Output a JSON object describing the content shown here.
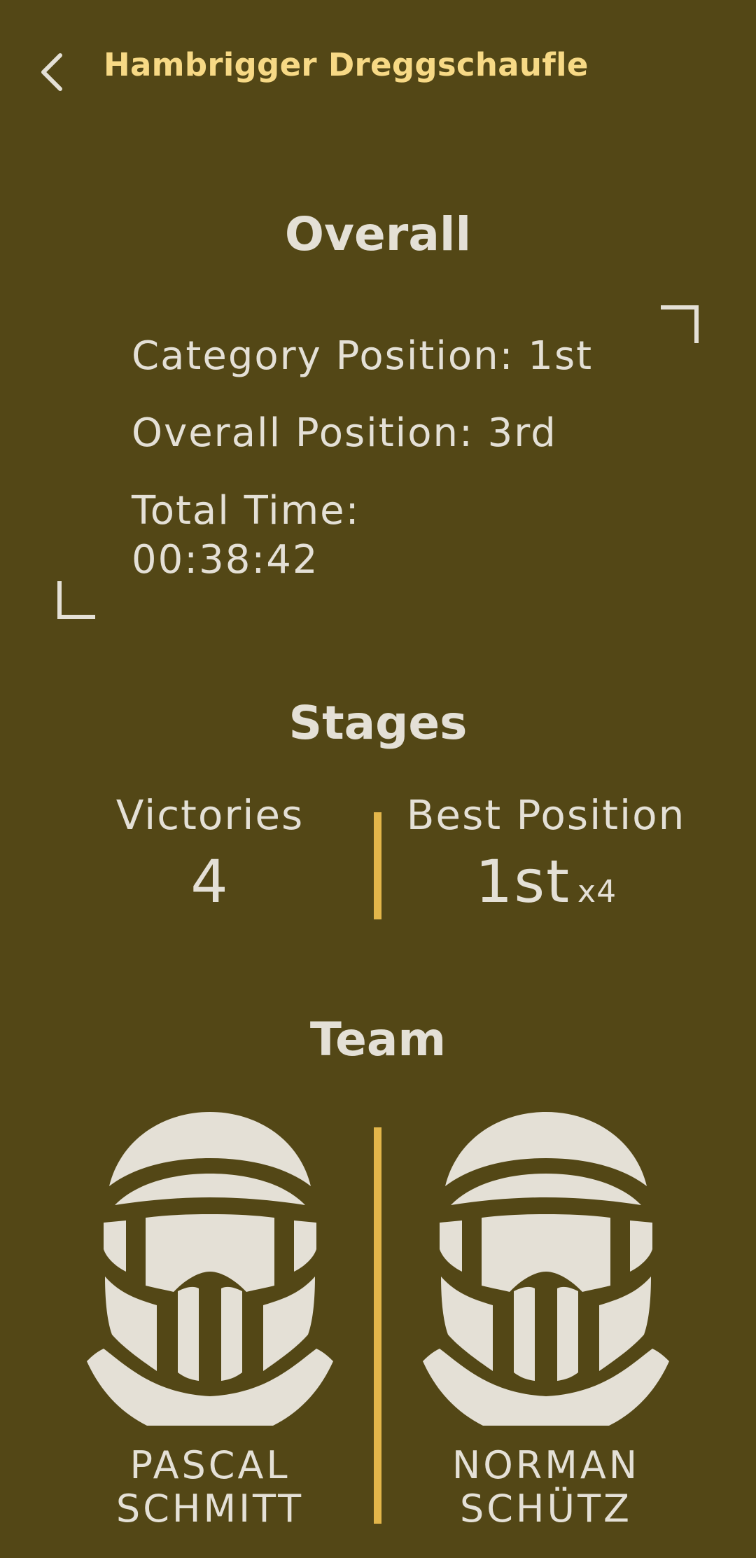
{
  "header": {
    "back_icon": "chevron-left-icon",
    "title": "Hambrigger Dreggschaufle"
  },
  "overall": {
    "title": "Overall",
    "category_position": "Category Position: 1st",
    "overall_position": "Overall Position: 3rd",
    "total_time_label": "Total Time:",
    "total_time_value": "00:38:42"
  },
  "stages": {
    "title": "Stages",
    "victories_label": "Victories",
    "victories_value": "4",
    "best_position_label": "Best Position",
    "best_position_value": "1st",
    "best_position_count": "x4"
  },
  "team": {
    "title": "Team",
    "drivers": [
      {
        "name_line1": "PASCAL",
        "name_line2": "SCHMITT",
        "icon": "helmet-icon"
      },
      {
        "name_line1": "NORMAN",
        "name_line2": "SCHÜTZ",
        "icon": "helmet-icon"
      }
    ]
  },
  "colors": {
    "background": "#534716",
    "title_accent": "#f7d985",
    "divider": "#e3b64a",
    "text": "#e4e0d6"
  }
}
